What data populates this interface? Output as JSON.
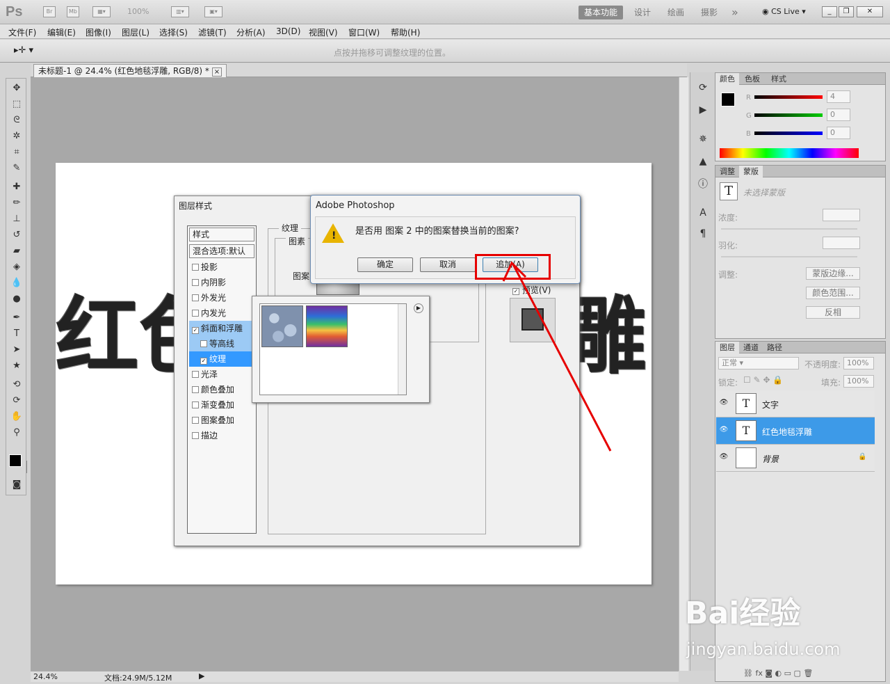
{
  "app": {
    "logo": "Ps",
    "br": "Br",
    "mb": "Mb",
    "zoom": "100%",
    "workspaces": [
      "基本功能",
      "设计",
      "绘画",
      "摄影"
    ],
    "more": "»",
    "cslive": "CS Live"
  },
  "menu": [
    "文件(F)",
    "编辑(E)",
    "图像(I)",
    "图层(L)",
    "选择(S)",
    "滤镜(T)",
    "分析(A)",
    "3D(D)",
    "视图(V)",
    "窗口(W)",
    "帮助(H)"
  ],
  "options": {
    "hint": "点按并拖移可调整纹理的位置。"
  },
  "document": {
    "tab": "未标题-1 @ 24.4% (红色地毯浮雕, RGB/8) *",
    "close": "×",
    "text_left": "红色",
    "text_right": "雕"
  },
  "status": {
    "zoom": "24.4%",
    "doc": "文档:24.9M/5.12M"
  },
  "color_panel": {
    "tabs": [
      "颜色",
      "色板",
      "样式"
    ],
    "r": "R",
    "g": "G",
    "b": "B",
    "r_val": "4",
    "g_val": "0",
    "b_val": "0"
  },
  "masks_panel": {
    "tabs": [
      "调整",
      "蒙版"
    ],
    "no_mask": "未选择蒙版",
    "density": "浓度:",
    "feather": "羽化:",
    "adjust": "调整:",
    "btn_edge": "蒙版边缘...",
    "btn_range": "颜色范围...",
    "btn_invert": "反相"
  },
  "layers_panel": {
    "tabs": [
      "图层",
      "通道",
      "路径"
    ],
    "blend": "正常",
    "opacity_label": "不透明度:",
    "opacity": "100%",
    "lock": "锁定:",
    "fill_label": "填充:",
    "fill": "100%",
    "layers": [
      {
        "name": "文字",
        "thumb": "T"
      },
      {
        "name": "红色地毯浮雕",
        "thumb": "T"
      },
      {
        "name": "背景",
        "thumb": ""
      }
    ],
    "footer": "fx"
  },
  "layer_style": {
    "title": "图层样式",
    "styles": "样式",
    "blend": "混合选项:默认",
    "items": [
      {
        "label": "投影",
        "checked": false
      },
      {
        "label": "内阴影",
        "checked": false
      },
      {
        "label": "外发光",
        "checked": false
      },
      {
        "label": "内发光",
        "checked": false
      },
      {
        "label": "斜面和浮雕",
        "checked": true
      },
      {
        "label": "等高线",
        "checked": false
      },
      {
        "label": "纹理",
        "checked": true
      },
      {
        "label": "光泽",
        "checked": false
      },
      {
        "label": "颜色叠加",
        "checked": false
      },
      {
        "label": "渐变叠加",
        "checked": false
      },
      {
        "label": "图案叠加",
        "checked": false
      },
      {
        "label": "描边",
        "checked": false
      }
    ],
    "group": "纹理",
    "subgroup": "图素",
    "pattern_label": "图案",
    "preview": "预览(V)"
  },
  "alert": {
    "title": "Adobe Photoshop",
    "message": "是否用 图案 2 中的图案替换当前的图案?",
    "ok": "确定",
    "cancel": "取消",
    "append": "追加(A)"
  },
  "watermark": {
    "brand": "Bai经验",
    "url": "jingyan.baidu.com"
  },
  "colors": {
    "accent": "#3d9ae8",
    "annotation": "#e60000"
  }
}
